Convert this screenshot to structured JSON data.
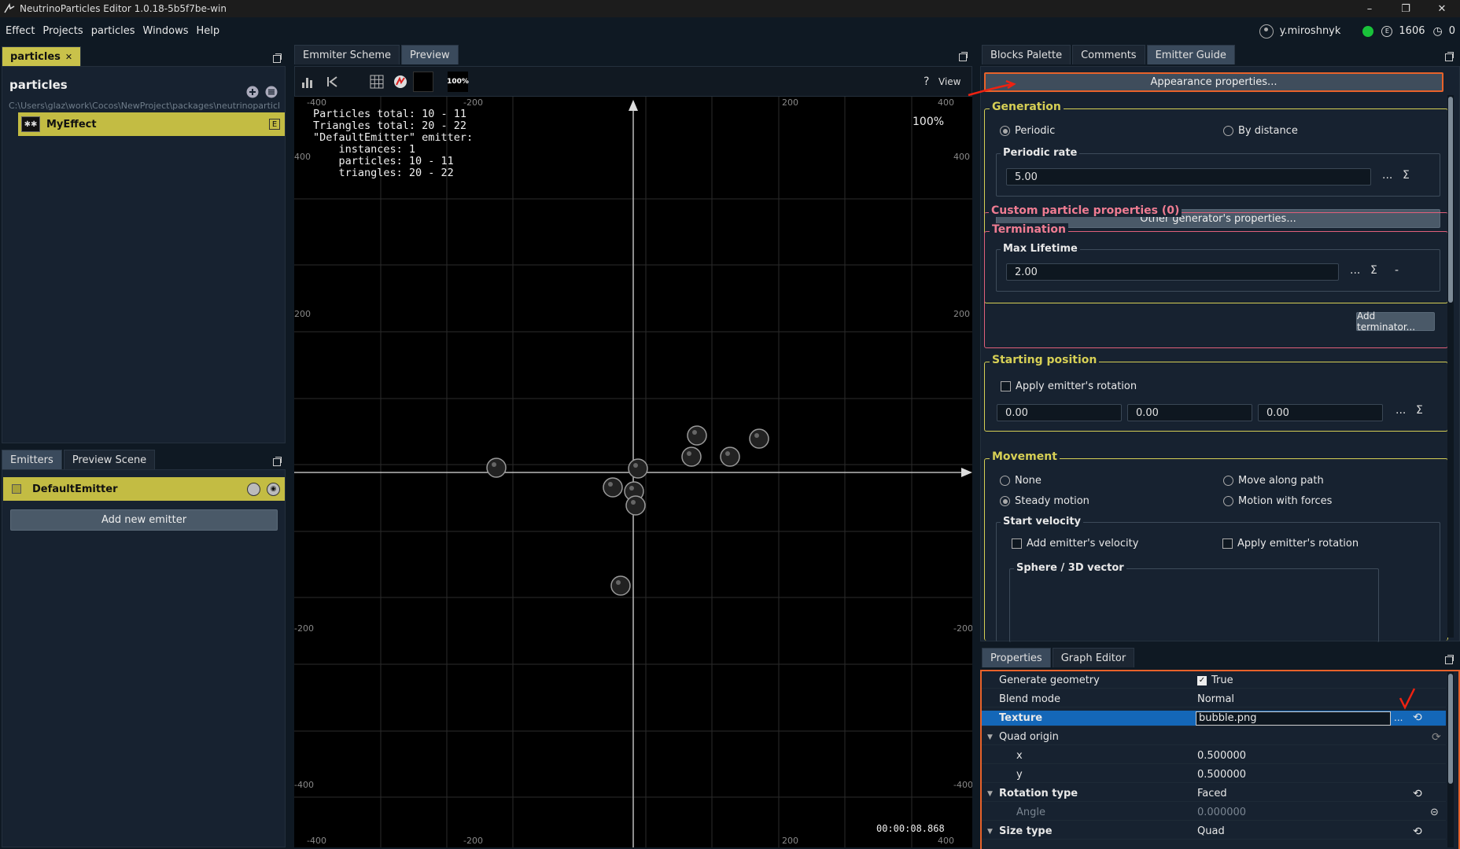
{
  "window": {
    "title": "NeutrinoParticles Editor 1.0.18-5b5f7be-win",
    "min": "–",
    "restore": "❐",
    "close": "✕"
  },
  "menu": [
    "Effect",
    "Projects",
    "particles",
    "Windows",
    "Help"
  ],
  "user": {
    "name": "y.miroshnyk",
    "credits": "1606",
    "clock_count": "0",
    "coin_symbol": "E",
    "clock_symbol": "◷"
  },
  "left_top": {
    "tab": "particles",
    "tab_close": "✕",
    "title": "particles",
    "path": "C:\\Users\\glaz\\work\\Cocos\\NewProject\\packages\\neutrinoparticles",
    "effect": "MyEffect",
    "effect_badge": "E"
  },
  "left_bottom": {
    "tabs": [
      "Emitters",
      "Preview Scene"
    ],
    "emitter": "DefaultEmitter",
    "add_button": "Add new emitter"
  },
  "center": {
    "tabs": [
      "Emmiter Scheme",
      "Preview"
    ],
    "view_label": "View",
    "zoom_btn": "100%",
    "zoom": "100%",
    "timer": "00:00:08.868",
    "stats": "Particles total: 10 - 11\nTriangles total: 20 - 22\n\"DefaultEmitter\" emitter:\n    instances: 1\n    particles: 10 - 11\n    triangles: 20 - 22",
    "axis_top": [
      "-400",
      "-200",
      "200",
      "400"
    ],
    "axis_bottom": [
      "-400",
      "-200",
      "200",
      "400"
    ],
    "axis_left": [
      "400",
      "200",
      "-200",
      "-400"
    ],
    "axis_right": [
      "-400",
      "-200",
      "200",
      "400"
    ]
  },
  "right_top": {
    "tabs": [
      "Blocks Palette",
      "Comments",
      "Emitter Guide"
    ],
    "appearance_btn": "Appearance properties...",
    "generation": {
      "title": "Generation",
      "opt1": "Periodic",
      "opt2": "By distance",
      "rate_title": "Periodic rate",
      "rate": "5.00",
      "other_btn": "Other generator's properties..."
    },
    "custom": {
      "title": "Custom particle properties (0)"
    },
    "termination": {
      "title": "Termination",
      "life_title": "Max Lifetime",
      "life": "2.00",
      "add_btn": "Add terminator..."
    },
    "start": {
      "title": "Starting position",
      "apply_rot": "Apply emitter's rotation",
      "x": "0.00",
      "y": "0.00",
      "z": "0.00"
    },
    "movement": {
      "title": "Movement",
      "none": "None",
      "path": "Move along path",
      "steady": "Steady motion",
      "forces": "Motion with forces",
      "vel_title": "Start velocity",
      "add_vel": "Add emitter's velocity",
      "apply_rot": "Apply emitter's rotation",
      "sphere": "Sphere / 3D vector"
    },
    "ellipsis": "...",
    "sigma": "Σ",
    "dash": "-"
  },
  "right_bottom": {
    "tabs": [
      "Properties",
      "Graph Editor"
    ],
    "rows": [
      {
        "k": "Generate geometry",
        "v": "True"
      },
      {
        "k": "Blend mode",
        "v": "Normal"
      },
      {
        "k": "Texture",
        "v": "bubble.png"
      },
      {
        "k": "Quad origin",
        "v": ""
      },
      {
        "k": "x",
        "v": "0.500000"
      },
      {
        "k": "y",
        "v": "0.500000"
      },
      {
        "k": "Rotation type",
        "v": "Faced"
      },
      {
        "k": "Angle",
        "v": "0.000000"
      },
      {
        "k": "Size type",
        "v": "Quad"
      }
    ]
  }
}
